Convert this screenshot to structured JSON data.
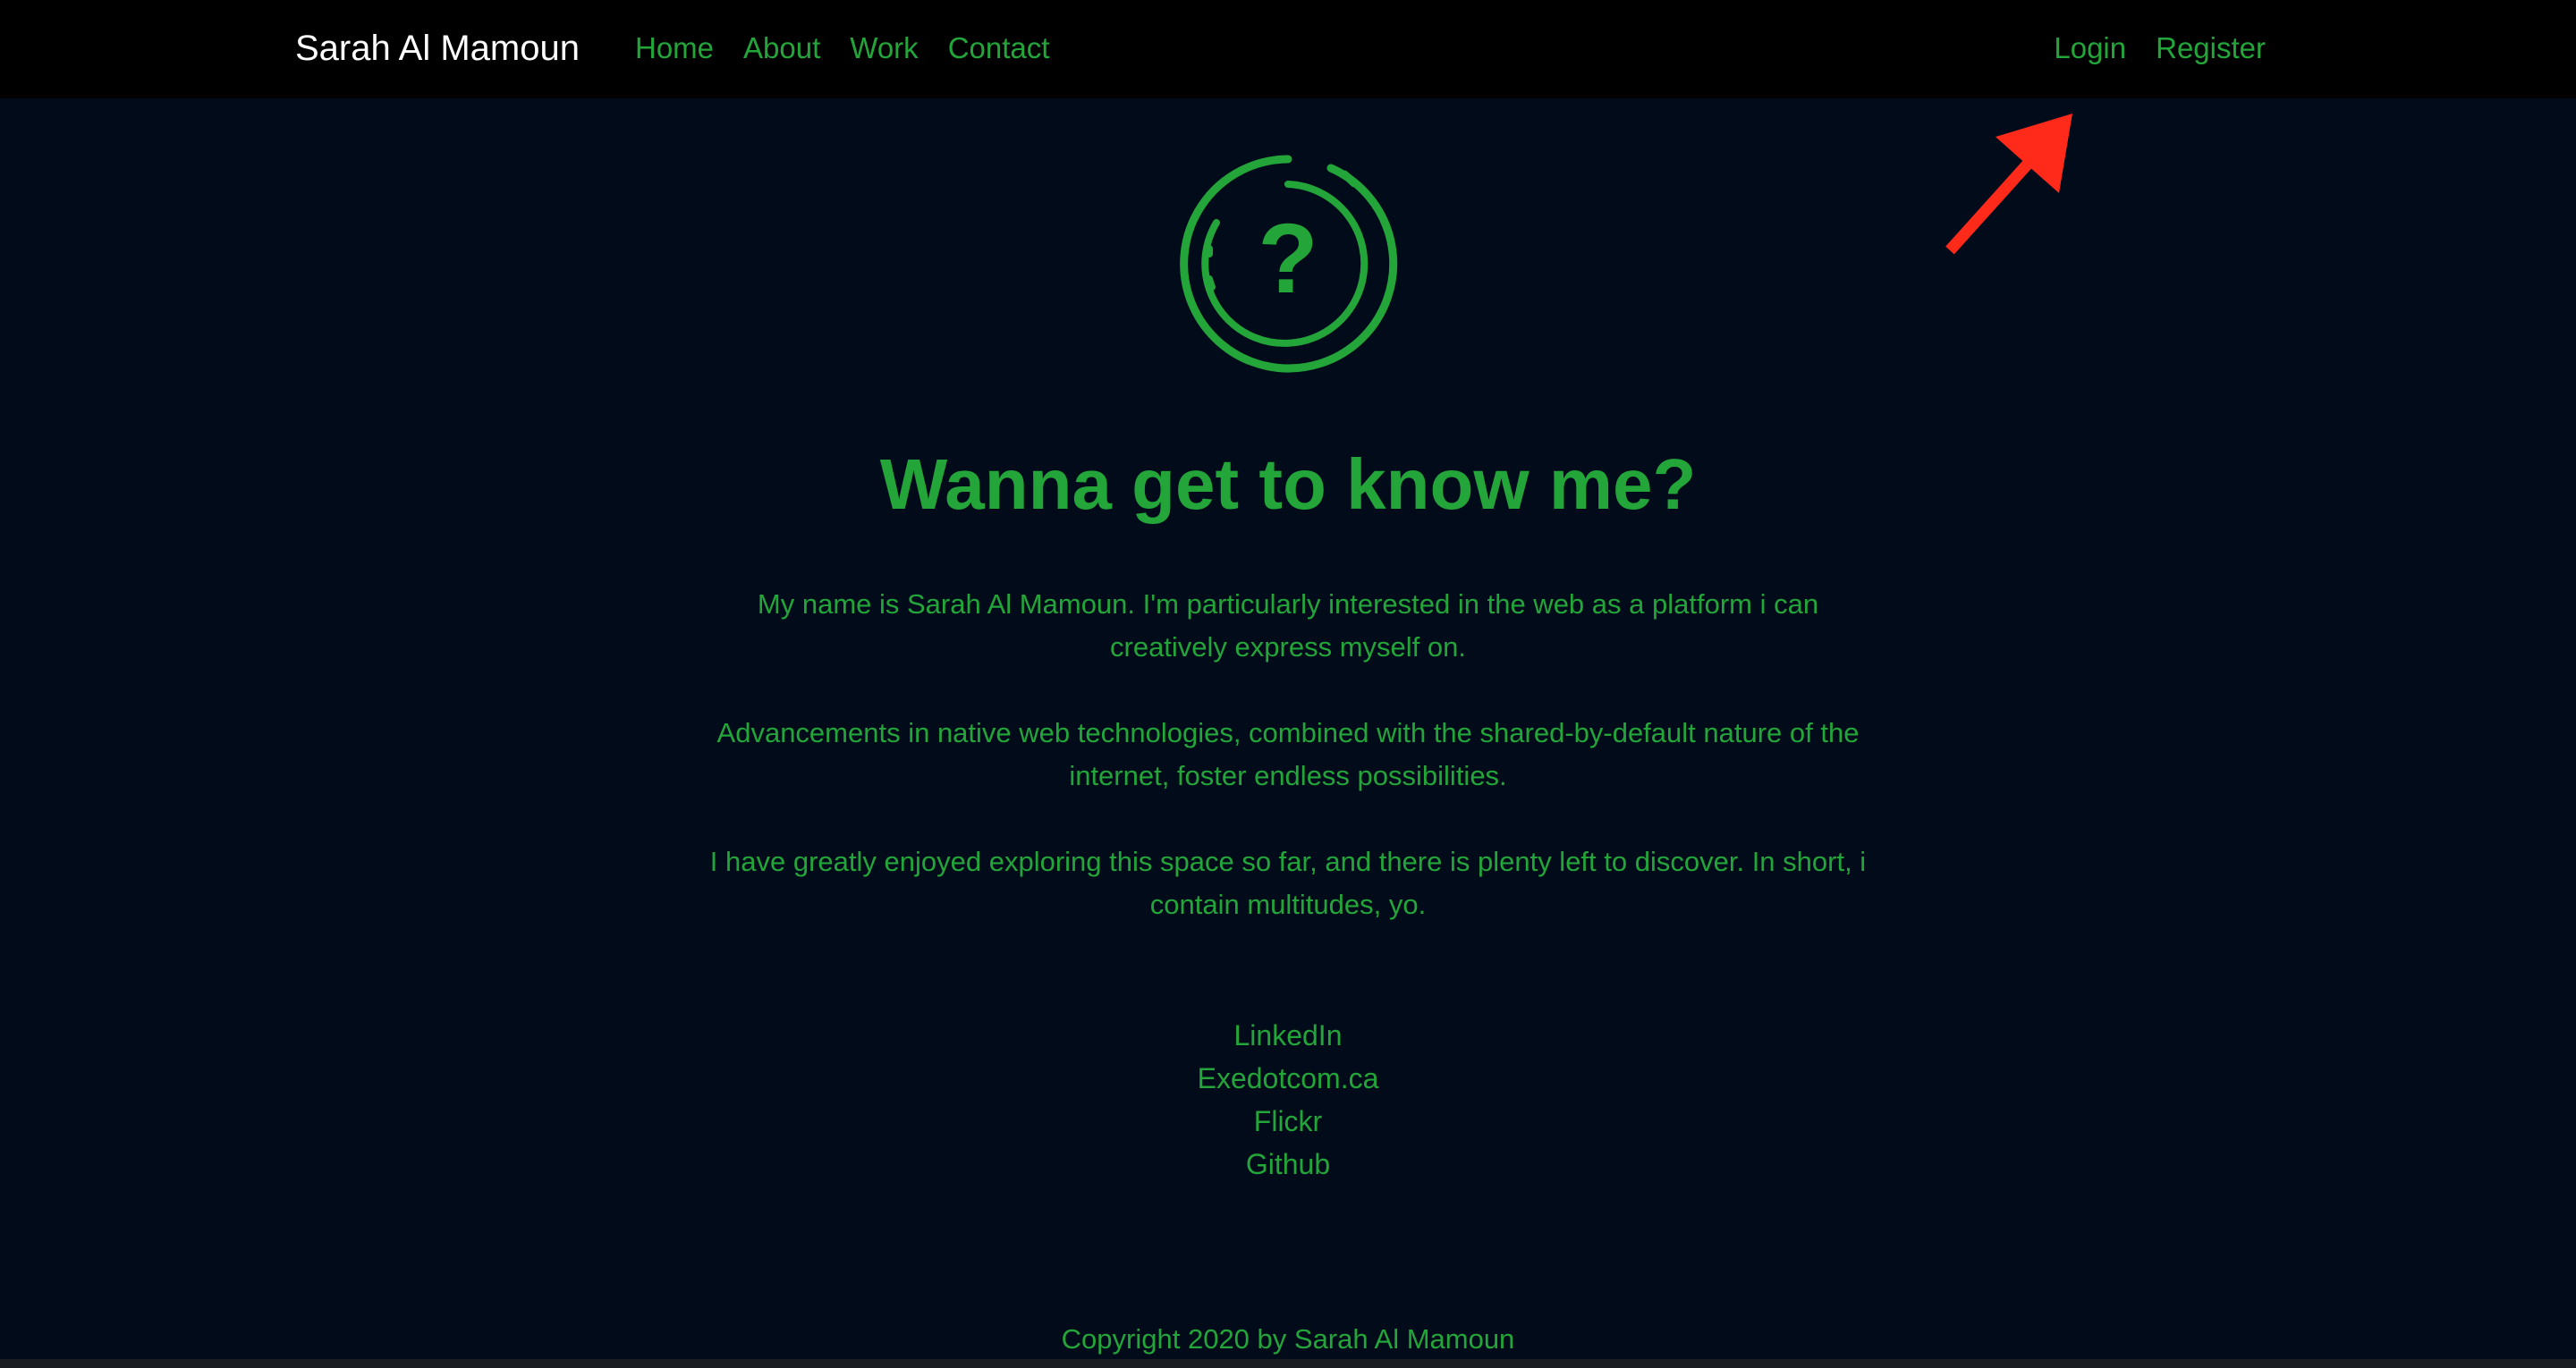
{
  "colors": {
    "background": "#010b1a",
    "navbar": "#000000",
    "accent": "#23a53a",
    "brand_text": "#ffffff",
    "annotation_arrow": "#ff2a1a"
  },
  "navbar": {
    "brand": "Sarah Al Mamoun",
    "links": [
      "Home",
      "About",
      "Work",
      "Contact"
    ],
    "auth": {
      "login": "Login",
      "register": "Register"
    }
  },
  "hero": {
    "icon": "question-circle-icon",
    "icon_glyph": "?",
    "heading": "Wanna get to know me?"
  },
  "bio": {
    "paragraphs": [
      "My name is Sarah Al Mamoun. I'm particularly interested in the web as a platform i can creatively express myself on.",
      "Advancements in native web technologies, combined with the shared-by-default nature of the internet, foster endless possibilities.",
      "I have greatly enjoyed exploring this space so far, and there is plenty left to discover. In short, i contain multitudes, yo."
    ]
  },
  "social_links": [
    "LinkedIn",
    "Exedotcom.ca",
    "Flickr",
    "Github"
  ],
  "footer": {
    "copyright": "Copyright 2020 by Sarah Al Mamoun"
  },
  "annotation": {
    "icon": "red-arrow-icon"
  }
}
